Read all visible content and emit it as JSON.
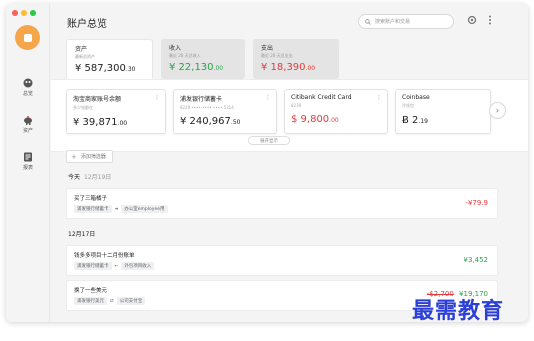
{
  "colors": {
    "green": "#2aa34a",
    "red": "#e23b3b",
    "accent": "#f5a54a",
    "neutral": "#222222"
  },
  "window": {
    "title": "账户总览"
  },
  "sidebar": {
    "items": [
      {
        "label": "总览",
        "icon": "overview-icon"
      },
      {
        "label": "资产",
        "icon": "piggy-bank-icon"
      },
      {
        "label": "报表",
        "icon": "report-icon"
      }
    ]
  },
  "search": {
    "placeholder": "搜索账户和交易"
  },
  "summary": {
    "assets": {
      "label": "资产",
      "sub": "最新总资产",
      "amount": "¥ 587,300",
      "decimal": ".30"
    },
    "income": {
      "label": "收入",
      "sub": "最近 28 天总收入",
      "amount": "¥ 22,130",
      "decimal": ".00"
    },
    "expense": {
      "label": "支出",
      "sub": "最近 28 天总支出",
      "amount": "¥ 18,390",
      "decimal": ".00"
    }
  },
  "accounts": [
    {
      "name": "淘宝商家账号余额",
      "sub": "多少钱都在",
      "amount": "¥ 39,871",
      "decimal": ".00"
    },
    {
      "name": "浦发银行储蓄卡",
      "sub": "8229 •••• •••• •••• 5314",
      "amount": "¥ 240,967",
      "decimal": ".50"
    },
    {
      "name": "Citibank Credit Card",
      "sub": "8239",
      "amount": "$ 9,800",
      "decimal": ".00"
    },
    {
      "name": "Coinbase",
      "sub": "冷钱包",
      "amount": "Ƀ 2",
      "decimal": ".19"
    }
  ],
  "expand_label": "展开显示",
  "filter_label": "添加筛选器",
  "days": [
    {
      "label": "今天",
      "date": "12月19日"
    },
    {
      "label": "12月17日",
      "date": ""
    }
  ],
  "transactions": [
    {
      "name": "买了三箱橘子",
      "from": "浦发银行储蓄卡",
      "to": "办公室employee用",
      "amount": "-¥79.9"
    },
    {
      "name": "钱多多项目十二月份账单",
      "from": "浦发银行储蓄卡",
      "to": "外包项目收入",
      "amount": "¥3,452"
    },
    {
      "name": "换了一些美元",
      "from": "浦发银行美元",
      "to": "公司支付宝",
      "amount": "-$2,700",
      "amount2": "¥19,170"
    }
  ],
  "watermark": "最需教育"
}
